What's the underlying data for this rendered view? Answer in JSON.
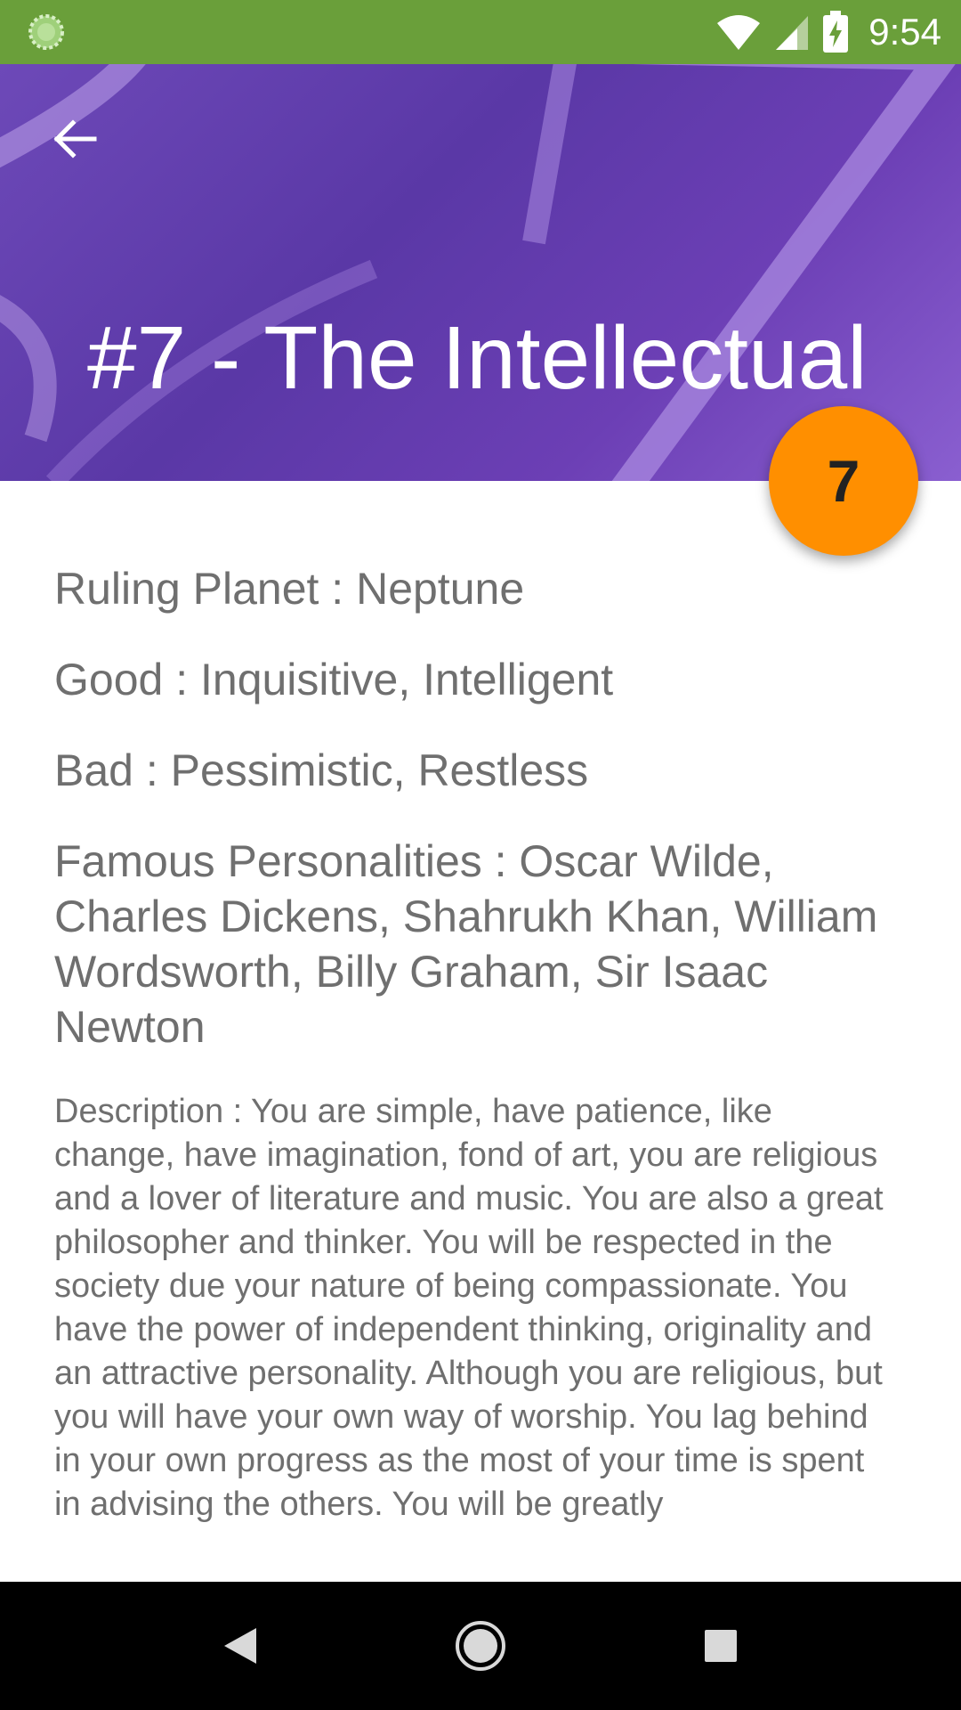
{
  "status_bar": {
    "time": "9:54",
    "icons": [
      "notification-icon",
      "wifi-icon",
      "signal-icon",
      "battery-charging-icon"
    ]
  },
  "header": {
    "title": "#7 - The Intellectual",
    "fab_label": "7",
    "colors": {
      "bg": "#5a38a6",
      "fab": "#ff8f00"
    }
  },
  "details": {
    "ruling_planet": "Ruling Planet :  Neptune",
    "good": "Good :  Inquisitive, Intelligent",
    "bad": "Bad :  Pessimistic, Restless",
    "famous": "Famous Personalities :  Oscar Wilde, Charles Dickens, Shahrukh Khan, William Wordsworth, Billy Graham, Sir Isaac Newton",
    "description": "Description :  You are simple, have patience, like change, have imagination, fond of art, you are religious and a lover of literature and music. You are also a great philosopher and thinker. You will be respected in the society due your nature of being compassionate. You have the power of independent thinking, originality and an attractive personality. Although you are religious, but you will have your own way of worship. You lag behind in your own progress as the most of your time is spent in advising the others. You will be greatly"
  },
  "nav_bar": {
    "buttons": [
      "back-nav-icon",
      "home-nav-icon",
      "recents-nav-icon"
    ]
  }
}
